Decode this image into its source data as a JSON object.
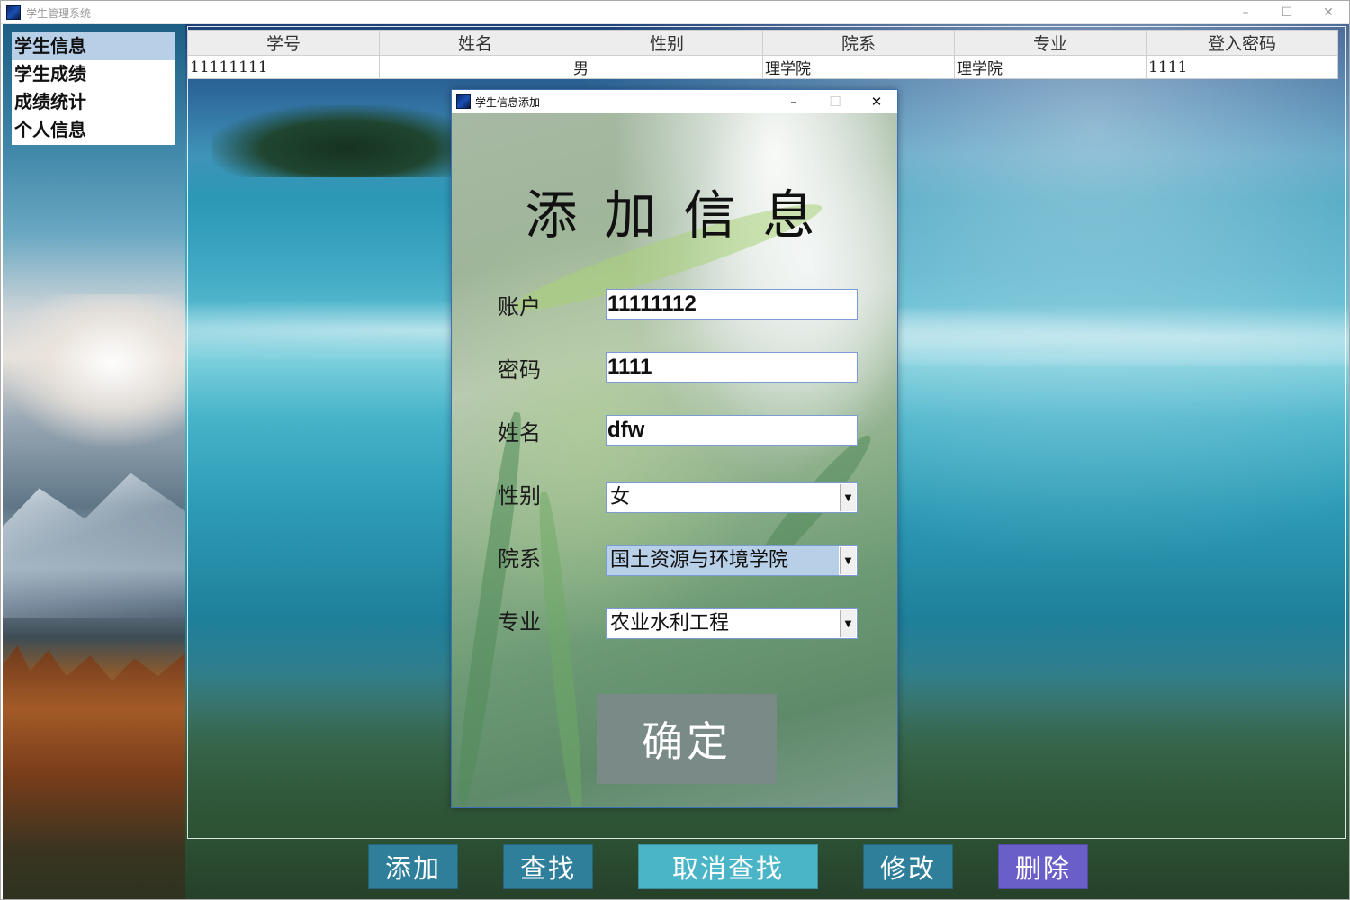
{
  "window": {
    "title": "学生管理系统",
    "controls": {
      "minimize": "–",
      "maximize": "☐",
      "close": "✕"
    }
  },
  "sidebar": {
    "items": [
      {
        "label": "学生信息",
        "active": true
      },
      {
        "label": "学生成绩",
        "active": false
      },
      {
        "label": "成绩统计",
        "active": false
      },
      {
        "label": "个人信息",
        "active": false
      }
    ]
  },
  "table": {
    "headers": [
      "学号",
      "姓名",
      "性别",
      "院系",
      "专业",
      "登入密码"
    ],
    "rows": [
      [
        "11111111",
        "",
        "男",
        "理学院",
        "理学院",
        "1111"
      ]
    ]
  },
  "actions": {
    "add": "添加",
    "search": "查找",
    "cancel_search": "取消查找",
    "edit": "修改",
    "delete": "删除"
  },
  "colors": {
    "add": "#2f7f9b",
    "search": "#2f7f9b",
    "cancel_search": "#4bb5c8",
    "edit": "#2f7f9b",
    "delete": "#6a5fc9",
    "nav_active": "#b8cfe8",
    "confirm": "#7a8a87"
  },
  "dialog": {
    "title": "学生信息添加",
    "heading": "添加信息",
    "controls": {
      "minimize": "–",
      "maximize": "☐",
      "close": "✕"
    },
    "fields": {
      "account": {
        "label": "账户",
        "value": "11111112"
      },
      "password": {
        "label": "密码",
        "value": "1111"
      },
      "name": {
        "label": "姓名",
        "value": "dfw"
      },
      "gender": {
        "label": "性别",
        "value": "女"
      },
      "department": {
        "label": "院系",
        "value": "国土资源与环境学院"
      },
      "major": {
        "label": "专业",
        "value": "农业水利工程"
      }
    },
    "confirm": "确定"
  }
}
